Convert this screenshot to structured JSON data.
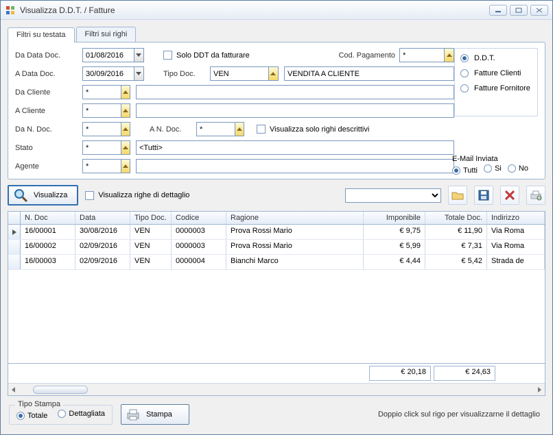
{
  "window": {
    "title": "Visualizza D.D.T. / Fatture"
  },
  "tabs": {
    "testata": "Filtri su testata",
    "righi": "Filtri sui righi"
  },
  "filters": {
    "da_data_doc_label": "Da Data Doc.",
    "da_data_doc_value": "01/08/2016",
    "a_data_doc_label": "A Data Doc.",
    "a_data_doc_value": "30/09/2016",
    "da_cliente_label": "Da Cliente",
    "da_cliente_value": "*",
    "a_cliente_label": "A Cliente",
    "a_cliente_value": "*",
    "da_n_doc_label": "Da N. Doc.",
    "da_n_doc_value": "*",
    "a_n_doc_label": "A N. Doc.",
    "a_n_doc_value": "*",
    "stato_label": "Stato",
    "stato_value": "*",
    "stato_desc": "<Tutti>",
    "agente_label": "Agente",
    "agente_value": "*",
    "solo_ddt_label": "Solo DDT da fatturare",
    "tipo_doc_label": "Tipo Doc.",
    "tipo_doc_value": "VEN",
    "tipo_doc_desc": "VENDITA A CLIENTE",
    "cod_pag_label": "Cod. Pagamento",
    "cod_pag_value": "*",
    "vis_righi_label": "Visualizza solo righi descrittivi"
  },
  "doc_type_options": {
    "ddt": "D.D.T.",
    "fatt_cli": "Fatture Clienti",
    "fatt_for": "Fatture Fornitore"
  },
  "email": {
    "label": "E-Mail Inviata",
    "tutti": "Tutti",
    "si": "Si",
    "no": "No"
  },
  "actions": {
    "visualizza": "Visualizza",
    "dettaglio_check": "Visualizza righe di dettaglio"
  },
  "grid": {
    "headers": {
      "ndoc": "N. Doc",
      "data": "Data",
      "tipo": "Tipo Doc.",
      "codice": "Codice",
      "ragione": "Ragione",
      "imponibile": "Imponibile",
      "totale": "Totale Doc.",
      "indirizzo": "Indirizzo"
    },
    "rows": [
      {
        "ndoc": "16/00001",
        "data": "30/08/2016",
        "tipo": "VEN",
        "codice": "0000003",
        "ragione": "Prova Rossi Mario",
        "imponibile": "€ 9,75",
        "totale": "€ 11,90",
        "indirizzo": "Via Roma"
      },
      {
        "ndoc": "16/00002",
        "data": "02/09/2016",
        "tipo": "VEN",
        "codice": "0000003",
        "ragione": "Prova Rossi Mario",
        "imponibile": "€ 5,99",
        "totale": "€ 7,31",
        "indirizzo": "Via Roma"
      },
      {
        "ndoc": "16/00003",
        "data": "02/09/2016",
        "tipo": "VEN",
        "codice": "0000004",
        "ragione": "Bianchi Marco",
        "imponibile": "€ 4,44",
        "totale": "€ 5,42",
        "indirizzo": "Strada de"
      }
    ],
    "totals": {
      "imponibile": "€ 20,18",
      "totale": "€ 24,63"
    }
  },
  "print": {
    "group_label": "Tipo Stampa",
    "totale": "Totale",
    "dettagliata": "Dettagliata",
    "stampa": "Stampa"
  },
  "hint": "Doppio click sul rigo per visualizzarne il dettaglio"
}
